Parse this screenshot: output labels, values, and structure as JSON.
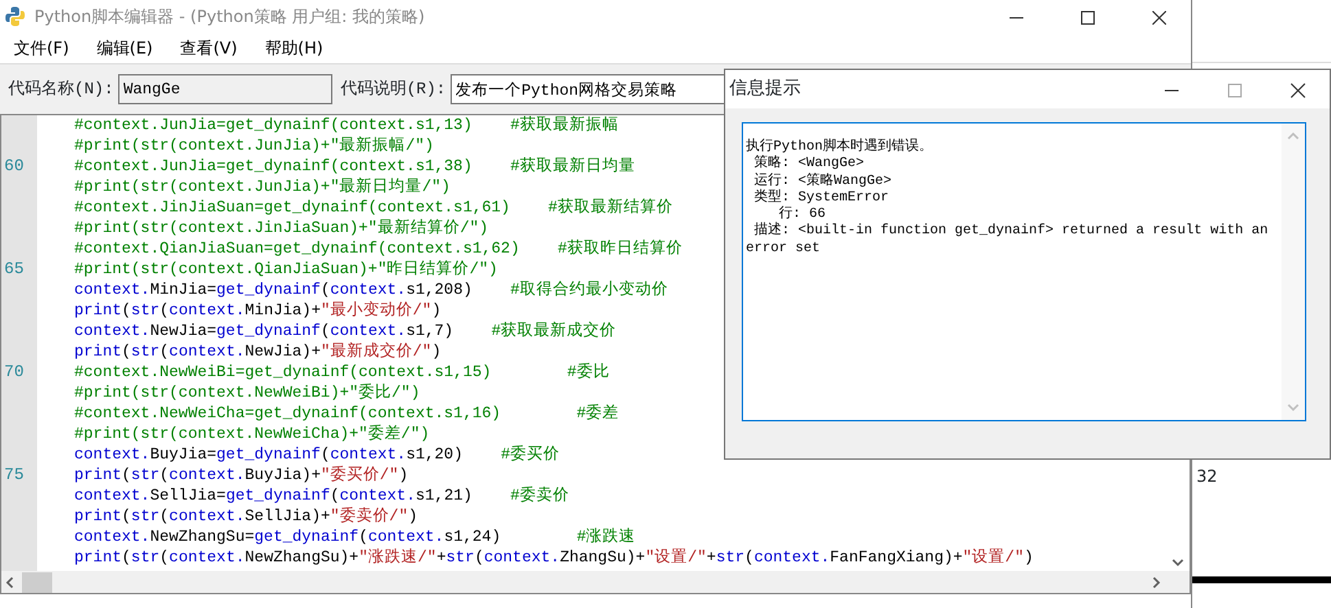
{
  "window": {
    "title": "Python脚本编辑器 - (Python策略 用户组: 我的策略)"
  },
  "menu": [
    "文件(F)",
    "编辑(E)",
    "查看(V)",
    "帮助(H)"
  ],
  "fields": [
    {
      "label": "代码名称(N):",
      "value": "WangGe",
      "disabled": true
    },
    {
      "label": "代码说明(R):",
      "value": "发布一个Python网格交易策略",
      "disabled": false
    }
  ],
  "editor": {
    "lines": [
      {
        "tokens": [
          {
            "kind": "comment",
            "text": "#context.JunJia=get_dynainf(context.s1,13)    #获取最新振幅"
          }
        ]
      },
      {
        "tokens": [
          {
            "kind": "comment",
            "text": "#print(str(context.JunJia)+\"最新振幅/\")"
          }
        ]
      },
      {
        "number": "60",
        "tokens": [
          {
            "kind": "comment",
            "text": "#context.JunJia=get_dynainf(context.s1,38)    #获取最新日均量"
          }
        ]
      },
      {
        "tokens": [
          {
            "kind": "comment",
            "text": "#print(str(context.JunJia)+\"最新日均量/\")"
          }
        ]
      },
      {
        "tokens": [
          {
            "kind": "comment",
            "text": "#context.JinJiaSuan=get_dynainf(context.s1,61)    #获取最新结算价"
          }
        ]
      },
      {
        "tokens": [
          {
            "kind": "comment",
            "text": "#print(str(context.JinJiaSuan)+\"最新结算价/\")"
          }
        ]
      },
      {
        "tokens": [
          {
            "kind": "comment",
            "text": "#context.QianJiaSuan=get_dynainf(context.s1,62)    #获取昨日结算价"
          }
        ]
      },
      {
        "number": "65",
        "tokens": [
          {
            "kind": "comment",
            "text": "#print(str(context.QianJiaSuan)+\"昨日结算价/\")"
          }
        ]
      },
      {
        "tokens": [
          {
            "kind": "name",
            "text": "context."
          },
          {
            "kind": "plain",
            "text": "MinJia="
          },
          {
            "kind": "name",
            "text": "get_dynainf"
          },
          {
            "kind": "plain",
            "text": "("
          },
          {
            "kind": "name",
            "text": "context."
          },
          {
            "kind": "plain",
            "text": "s1,208)    "
          },
          {
            "kind": "comment",
            "text": "#取得合约最小变动价"
          }
        ]
      },
      {
        "tokens": [
          {
            "kind": "name",
            "text": "print"
          },
          {
            "kind": "plain",
            "text": "("
          },
          {
            "kind": "name",
            "text": "str"
          },
          {
            "kind": "plain",
            "text": "("
          },
          {
            "kind": "name",
            "text": "context."
          },
          {
            "kind": "plain",
            "text": "MinJia)+"
          },
          {
            "kind": "string",
            "text": "\"最小变动价/\""
          },
          {
            "kind": "plain",
            "text": ")"
          }
        ]
      },
      {
        "tokens": [
          {
            "kind": "name",
            "text": "context."
          },
          {
            "kind": "plain",
            "text": "NewJia="
          },
          {
            "kind": "name",
            "text": "get_dynainf"
          },
          {
            "kind": "plain",
            "text": "("
          },
          {
            "kind": "name",
            "text": "context."
          },
          {
            "kind": "plain",
            "text": "s1,7)    "
          },
          {
            "kind": "comment",
            "text": "#获取最新成交价"
          }
        ]
      },
      {
        "tokens": [
          {
            "kind": "name",
            "text": "print"
          },
          {
            "kind": "plain",
            "text": "("
          },
          {
            "kind": "name",
            "text": "str"
          },
          {
            "kind": "plain",
            "text": "("
          },
          {
            "kind": "name",
            "text": "context."
          },
          {
            "kind": "plain",
            "text": "NewJia)+"
          },
          {
            "kind": "string",
            "text": "\"最新成交价/\""
          },
          {
            "kind": "plain",
            "text": ")"
          }
        ]
      },
      {
        "number": "70",
        "tokens": [
          {
            "kind": "comment",
            "text": "#context.NewWeiBi=get_dynainf(context.s1,15)        #委比"
          }
        ]
      },
      {
        "tokens": [
          {
            "kind": "comment",
            "text": "#print(str(context.NewWeiBi)+\"委比/\")"
          }
        ]
      },
      {
        "tokens": [
          {
            "kind": "comment",
            "text": "#context.NewWeiCha=get_dynainf(context.s1,16)        #委差"
          }
        ]
      },
      {
        "tokens": [
          {
            "kind": "comment",
            "text": "#print(str(context.NewWeiCha)+\"委差/\")"
          }
        ]
      },
      {
        "tokens": [
          {
            "kind": "name",
            "text": "context."
          },
          {
            "kind": "plain",
            "text": "BuyJia="
          },
          {
            "kind": "name",
            "text": "get_dynainf"
          },
          {
            "kind": "plain",
            "text": "("
          },
          {
            "kind": "name",
            "text": "context."
          },
          {
            "kind": "plain",
            "text": "s1,20)    "
          },
          {
            "kind": "comment",
            "text": "#委买价"
          }
        ]
      },
      {
        "number": "75",
        "tokens": [
          {
            "kind": "name",
            "text": "print"
          },
          {
            "kind": "plain",
            "text": "("
          },
          {
            "kind": "name",
            "text": "str"
          },
          {
            "kind": "plain",
            "text": "("
          },
          {
            "kind": "name",
            "text": "context."
          },
          {
            "kind": "plain",
            "text": "BuyJia)+"
          },
          {
            "kind": "string",
            "text": "\"委买价/\""
          },
          {
            "kind": "plain",
            "text": ")"
          }
        ]
      },
      {
        "tokens": [
          {
            "kind": "name",
            "text": "context."
          },
          {
            "kind": "plain",
            "text": "SellJia="
          },
          {
            "kind": "name",
            "text": "get_dynainf"
          },
          {
            "kind": "plain",
            "text": "("
          },
          {
            "kind": "name",
            "text": "context."
          },
          {
            "kind": "plain",
            "text": "s1,21)    "
          },
          {
            "kind": "comment",
            "text": "#委卖价"
          }
        ]
      },
      {
        "tokens": [
          {
            "kind": "name",
            "text": "print"
          },
          {
            "kind": "plain",
            "text": "("
          },
          {
            "kind": "name",
            "text": "str"
          },
          {
            "kind": "plain",
            "text": "("
          },
          {
            "kind": "name",
            "text": "context."
          },
          {
            "kind": "plain",
            "text": "SellJia)+"
          },
          {
            "kind": "string",
            "text": "\"委卖价/\""
          },
          {
            "kind": "plain",
            "text": ")"
          }
        ]
      },
      {
        "tokens": [
          {
            "kind": "name",
            "text": "context."
          },
          {
            "kind": "plain",
            "text": "NewZhangSu="
          },
          {
            "kind": "name",
            "text": "get_dynainf"
          },
          {
            "kind": "plain",
            "text": "("
          },
          {
            "kind": "name",
            "text": "context."
          },
          {
            "kind": "plain",
            "text": "s1,24)        "
          },
          {
            "kind": "comment",
            "text": "#涨跌速"
          }
        ]
      },
      {
        "tokens": [
          {
            "kind": "name",
            "text": "print"
          },
          {
            "kind": "plain",
            "text": "("
          },
          {
            "kind": "name",
            "text": "str"
          },
          {
            "kind": "plain",
            "text": "("
          },
          {
            "kind": "name",
            "text": "context."
          },
          {
            "kind": "plain",
            "text": "NewZhangSu)+"
          },
          {
            "kind": "string",
            "text": "\"涨跌速/\""
          },
          {
            "kind": "plain",
            "text": "+"
          },
          {
            "kind": "name",
            "text": "str"
          },
          {
            "kind": "plain",
            "text": "("
          },
          {
            "kind": "name",
            "text": "context."
          },
          {
            "kind": "plain",
            "text": "ZhangSu)+"
          },
          {
            "kind": "string",
            "text": "\"设置/\""
          },
          {
            "kind": "plain",
            "text": "+"
          },
          {
            "kind": "name",
            "text": "str"
          },
          {
            "kind": "plain",
            "text": "("
          },
          {
            "kind": "name",
            "text": "context."
          },
          {
            "kind": "plain",
            "text": "FanFangXiang)+"
          },
          {
            "kind": "string",
            "text": "\"设置/\""
          },
          {
            "kind": "plain",
            "text": ")"
          }
        ]
      }
    ]
  },
  "dialog": {
    "title": "信息提示",
    "message_lines": [
      "执行Python脚本时遇到错误。",
      " 策略: <WangGe>",
      " 运行: <策略WangGe>",
      " 类型: SystemError",
      "    行: 66",
      " 描述: <built-in function get_dynainf> returned a result with an error set"
    ]
  },
  "background_window": {
    "text": "32"
  }
}
